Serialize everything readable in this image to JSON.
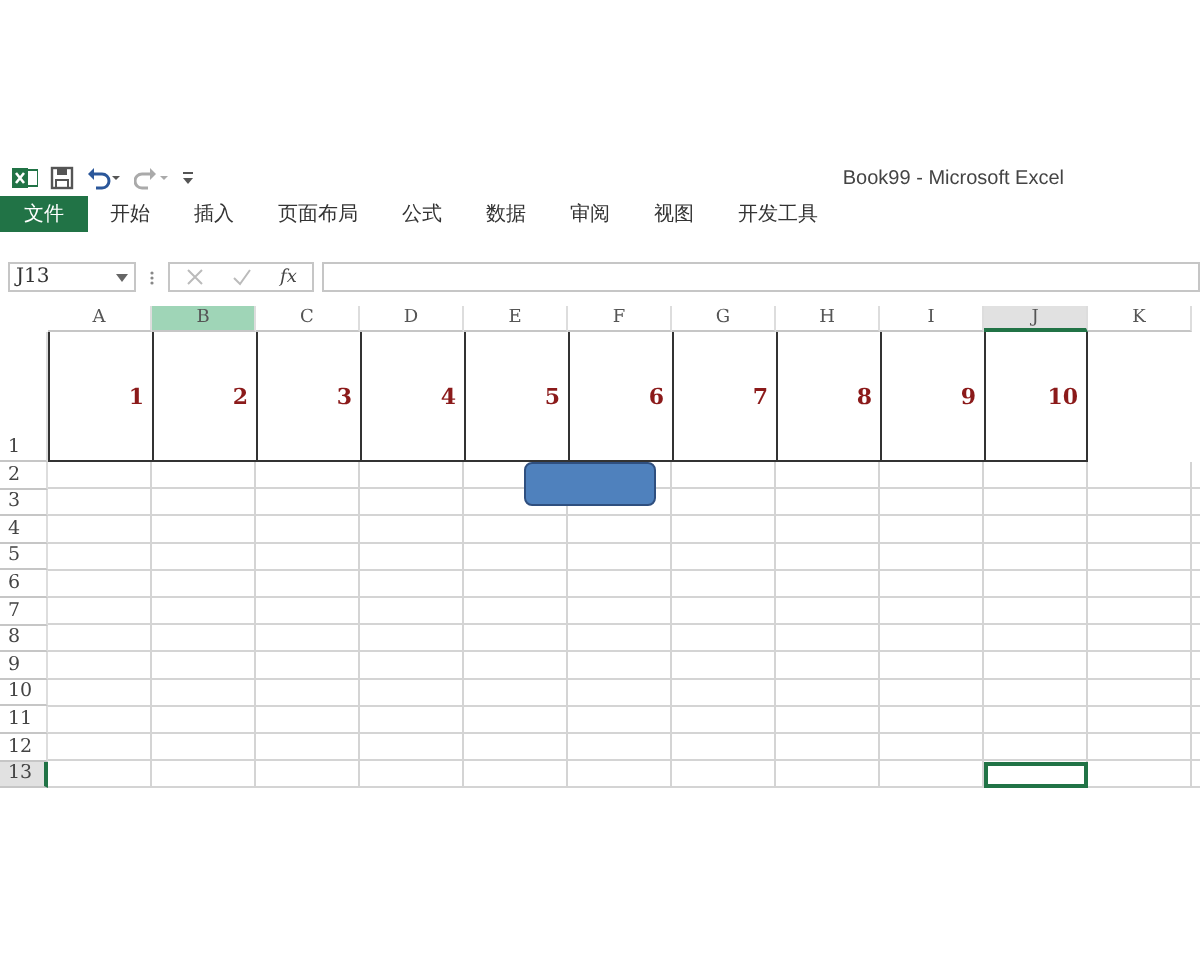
{
  "title_bar": {
    "title": "Book99 - Microsoft Excel"
  },
  "ribbon_tabs": [
    {
      "label": "文件",
      "kind": "file"
    },
    {
      "label": "开始",
      "kind": "tab"
    },
    {
      "label": "插入",
      "kind": "tab"
    },
    {
      "label": "页面布局",
      "kind": "tab"
    },
    {
      "label": "公式",
      "kind": "tab"
    },
    {
      "label": "数据",
      "kind": "tab"
    },
    {
      "label": "审阅",
      "kind": "tab"
    },
    {
      "label": "视图",
      "kind": "tab"
    },
    {
      "label": "开发工具",
      "kind": "tab"
    }
  ],
  "formula_bar": {
    "name_box": "J13",
    "function_label": "fx"
  },
  "columns": [
    {
      "label": "A",
      "active": false,
      "highlighted": false
    },
    {
      "label": "B",
      "active": false,
      "highlighted": true
    },
    {
      "label": "C",
      "active": false,
      "highlighted": false
    },
    {
      "label": "D",
      "active": false,
      "highlighted": false
    },
    {
      "label": "E",
      "active": false,
      "highlighted": false
    },
    {
      "label": "F",
      "active": false,
      "highlighted": false
    },
    {
      "label": "G",
      "active": false,
      "highlighted": false
    },
    {
      "label": "H",
      "active": false,
      "highlighted": false
    },
    {
      "label": "I",
      "active": false,
      "highlighted": false
    },
    {
      "label": "J",
      "active": true,
      "highlighted": false
    },
    {
      "label": "K",
      "active": false,
      "highlighted": false
    }
  ],
  "rows": [
    {
      "label": "1",
      "active": false,
      "cells": [
        "1",
        "2",
        "3",
        "4",
        "5",
        "6",
        "7",
        "8",
        "9",
        "10"
      ]
    },
    {
      "label": "2",
      "active": false
    },
    {
      "label": "3",
      "active": false
    },
    {
      "label": "4",
      "active": false
    },
    {
      "label": "5",
      "active": false
    },
    {
      "label": "6",
      "active": false
    },
    {
      "label": "7",
      "active": false
    },
    {
      "label": "8",
      "active": false
    },
    {
      "label": "9",
      "active": false
    },
    {
      "label": "10",
      "active": false
    },
    {
      "label": "11",
      "active": false
    },
    {
      "label": "12",
      "active": false
    },
    {
      "label": "13",
      "active": true
    }
  ],
  "shapes": [
    {
      "kind": "rounded_rectangle"
    }
  ]
}
